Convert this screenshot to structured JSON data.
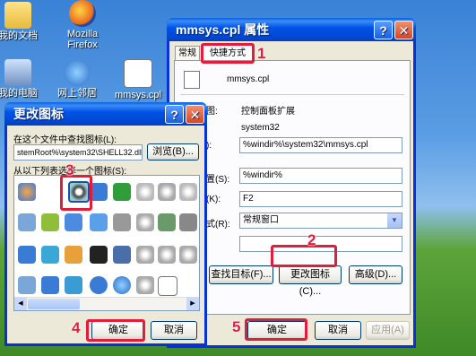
{
  "desktop": {
    "icons": [
      {
        "label": "我的文档"
      },
      {
        "label": "Mozilla Firefox"
      },
      {
        "label": "我的电脑"
      },
      {
        "label": "网上邻居"
      },
      {
        "label": "mmsys.cpl"
      }
    ]
  },
  "props_window": {
    "title": "mmsys.cpl 属性",
    "tabs": [
      "常规",
      "快捷方式"
    ],
    "file_name": "mmsys.cpl",
    "rows": [
      {
        "label": "图:",
        "value": "控制面板扩展"
      },
      {
        "label": "",
        "value": "system32"
      },
      {
        "label": "):",
        "value": "%windir%\\system32\\mmsys.cpl"
      },
      {
        "label": "置(S):",
        "value": "%windir%"
      },
      {
        "label": "(K):",
        "value": "F2"
      },
      {
        "label": "式(R):",
        "value": "常规窗口"
      },
      {
        "label": "",
        "value": ""
      }
    ],
    "find_target": "查找目标(F)...",
    "change_icon": "更改图标(C)...",
    "advanced": "高级(D)...",
    "ok": "确定",
    "cancel": "取消",
    "apply": "应用(A)"
  },
  "icon_dialog": {
    "title": "更改图标",
    "file_label": "在这个文件中查找图标(L):",
    "file_value": "stemRoot%\\system32\\SHELL32.dll",
    "browse": "浏览(B)...",
    "list_label": "从以下列表选择一个图标(S):",
    "ok": "确定",
    "cancel": "取消"
  },
  "annotations": [
    "1",
    "2",
    "3",
    "4",
    "5"
  ],
  "colors": {
    "highlight": "#e21d3c",
    "title_blue": "#0053e6"
  }
}
